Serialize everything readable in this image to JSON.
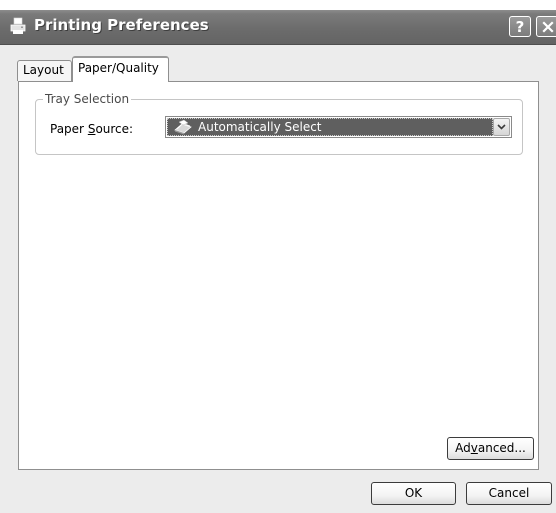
{
  "window": {
    "title": "Printing Preferences",
    "help_glyph": "?"
  },
  "tabs": [
    {
      "label": "Layout",
      "active": false
    },
    {
      "label": "Paper/Quality",
      "active": true
    }
  ],
  "tray_selection": {
    "group_label": "Tray Selection",
    "paper_source": {
      "label_before": "Paper ",
      "label_access_key": "S",
      "label_after": "ource:",
      "selected_value": "Automatically Select",
      "icon": "printer-icon"
    }
  },
  "buttons": {
    "advanced": {
      "before": "Ad",
      "access_key": "v",
      "after": "anced..."
    },
    "ok": "OK",
    "cancel": "Cancel"
  },
  "colors": {
    "titlebar": "#6c6c6c",
    "window_face": "#ececec",
    "selection": "#5f5f5f"
  }
}
